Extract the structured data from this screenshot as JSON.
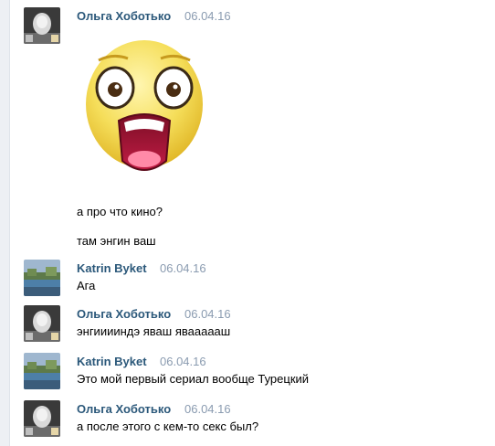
{
  "messages": [
    {
      "author": "Ольга Хоботько",
      "date": "06.04.16",
      "avatar": "olga",
      "texts": [],
      "sticker": "shocked-face-sticker"
    },
    {
      "texts": [
        "а про что кино?"
      ]
    },
    {
      "texts": [
        "там энгин ваш"
      ]
    },
    {
      "author": "Katrin Byket",
      "date": "06.04.16",
      "avatar": "katrin",
      "texts": [
        "Ага"
      ]
    },
    {
      "author": "Ольга Хоботько",
      "date": "06.04.16",
      "avatar": "olga",
      "texts": [
        "энгииииндэ яваш яваааааш"
      ]
    },
    {
      "author": "Katrin Byket",
      "date": "06.04.16",
      "avatar": "katrin",
      "texts": [
        "Это мой первый сериал вообще Турецкий"
      ]
    },
    {
      "author": "Ольга Хоботько",
      "date": "06.04.16",
      "avatar": "olga",
      "texts": [
        "а после этого с кем-то секс был?"
      ]
    }
  ],
  "colors": {
    "author": "#2b587a",
    "date": "#8a9bb0",
    "strip": "#edf0f4"
  }
}
